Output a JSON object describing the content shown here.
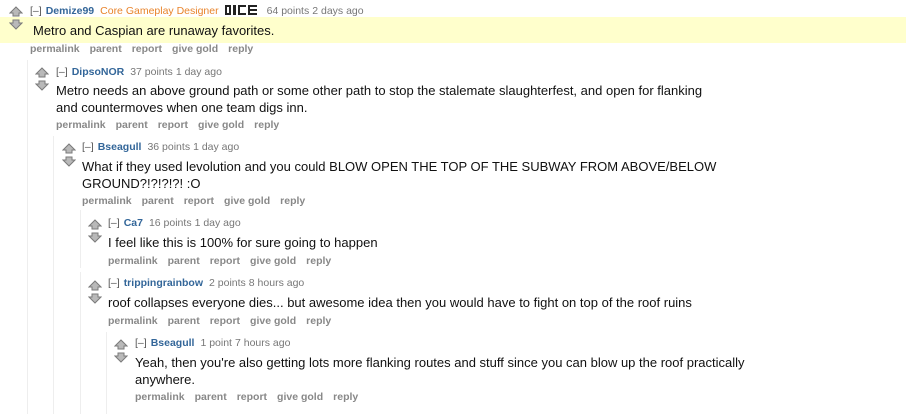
{
  "ui": {
    "toggle": "[–]",
    "colors": {
      "author": "#336699",
      "flair": "#e8832a",
      "highlight": "#ffffcc",
      "buttons": "#888888"
    },
    "icons": {
      "upvote": "upvote-arrow-icon",
      "downvote": "downvote-arrow-icon"
    }
  },
  "comments": [
    {
      "author": "Demize99",
      "flair": "Core Gameplay Designer",
      "flair_logo": "DICE",
      "score": "64 points",
      "time": "2 days ago",
      "body": [
        "Metro and Caspian are runaway favorites."
      ],
      "buttons": [
        "permalink",
        "parent",
        "report",
        "give gold",
        "reply"
      ]
    },
    {
      "author": "DipsoNOR",
      "score": "37 points",
      "time": "1 day ago",
      "body": [
        "Metro needs an above ground path or some other path to stop the stalemate slaughterfest, and open for flanking",
        "and countermoves when one team digs inn."
      ],
      "buttons": [
        "permalink",
        "parent",
        "report",
        "give gold",
        "reply"
      ]
    },
    {
      "author": "Bseagull",
      "score": "36 points",
      "time": "1 day ago",
      "body": [
        "What if they used levolution and you could BLOW OPEN THE TOP OF THE SUBWAY FROM ABOVE/BELOW",
        "GROUND?!?!?!?! :O"
      ],
      "buttons": [
        "permalink",
        "parent",
        "report",
        "give gold",
        "reply"
      ]
    },
    {
      "author": "Ca7",
      "score": "16 points",
      "time": "1 day ago",
      "body": [
        "I feel like this is 100% for sure going to happen"
      ],
      "buttons": [
        "permalink",
        "parent",
        "report",
        "give gold",
        "reply"
      ]
    },
    {
      "author": "trippingrainbow",
      "score": "2 points",
      "time": "8 hours ago",
      "body": [
        "roof collapses everyone dies... but awesome idea then you would have to fight on top of the roof ruins"
      ],
      "buttons": [
        "permalink",
        "parent",
        "report",
        "give gold",
        "reply"
      ]
    },
    {
      "author": "Bseagull",
      "score": "1 point",
      "time": "7 hours ago",
      "body": [
        "Yeah, then you're also getting lots more flanking routes and stuff since you can blow up the roof practically",
        "anywhere."
      ],
      "buttons": [
        "permalink",
        "parent",
        "report",
        "give gold",
        "reply"
      ]
    }
  ]
}
